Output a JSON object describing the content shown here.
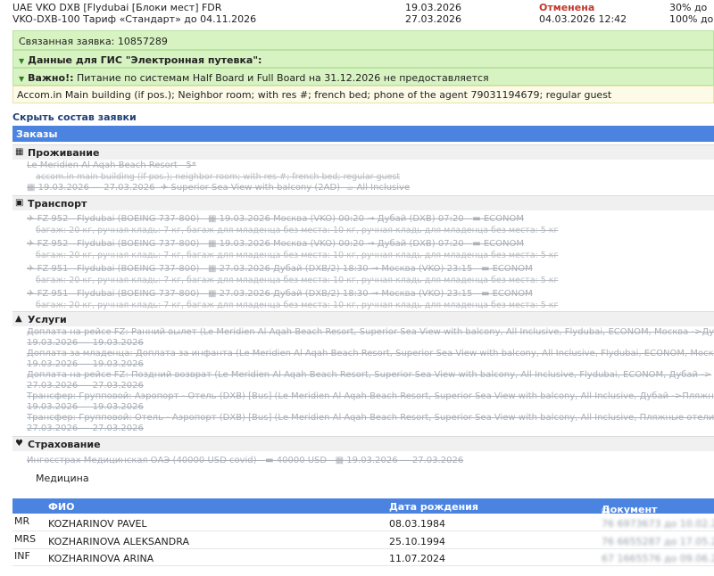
{
  "order": {
    "title_line1": "UAE VKO DXB [Flydubai [Блоки мест] FDR",
    "title_line2": "VKO-DXB-100 Тариф «Стандарт» до 04.11.2026",
    "date1": "19.03.2026",
    "date2": "27.03.2026",
    "status": "Отменена",
    "status_date": "04.03.2026 12:42",
    "pay1": "30% до",
    "pay2": "100% до"
  },
  "linked": {
    "label": "Связанная заявка:",
    "number": "10857289"
  },
  "gis_bar": "Данные для ГИС \"Электронная путевка\":",
  "important": {
    "label": "Важно!:",
    "text": "Питание по системам Half Board и Full Board на 31.12.2026 не предоставляется"
  },
  "accom_note": "Accom.in Main building (if pos.); Neighbor room; with res #; french bed; phone of the agent 79031194679; regular guest",
  "hide_link": "Скрыть состав заявки",
  "orders_title": "Заказы",
  "accommodation": {
    "title": "Проживание",
    "hotel": "Le Meridien Al Aqah Beach Resort",
    "stars": "5*",
    "note": "accom.in main building (if pos.); neighbor room; with res #; french bed; regular guest",
    "date_from": "19.03.2026",
    "date_to": "27.03.2026",
    "room": "Superior Sea View with balcony (2AD)",
    "meal": "All Inclusive"
  },
  "transport": {
    "title": "Транспорт",
    "flights": [
      {
        "code": "FZ 952",
        "carrier": "Flydubai (BOEING 737-800)",
        "route": "19.03.2026 Москва (VKO) 00:20 → Дубай (DXB) 07:20",
        "cls": "ECONOM",
        "bag": "багаж: 20 кг, ручная кладь: 7 кг, багаж для младенца без места: 10 кг, ручная кладь для младенца без места: 5 кг"
      },
      {
        "code": "FZ 952",
        "carrier": "Flydubai (BOEING 737-800)",
        "route": "19.03.2026 Москва (VKO) 00:20 → Дубай (DXB) 07:20",
        "cls": "ECONOM",
        "bag": "багаж: 20 кг, ручная кладь: 7 кг, багаж для младенца без места: 10 кг, ручная кладь для младенца без места: 5 кг"
      },
      {
        "code": "FZ 951",
        "carrier": "Flydubai (BOEING 737-800)",
        "route": "27.03.2026 Дубай (DXB/2) 18:30 → Москва (VKO) 23:15",
        "cls": "ECONOM",
        "bag": "багаж: 20 кг, ручная кладь: 7 кг, багаж для младенца без места: 10 кг, ручная кладь для младенца без места: 5 кг"
      },
      {
        "code": "FZ 951",
        "carrier": "Flydubai (BOEING 737-800)",
        "route": "27.03.2026 Дубай (DXB/2) 18:30 → Москва (VKO) 23:15",
        "cls": "ECONOM",
        "bag": "багаж: 20 кг, ручная кладь: 7 кг, багаж для младенца без места: 10 кг, ручная кладь для младенца без места: 5 кг"
      }
    ]
  },
  "services": {
    "title": "Услуги",
    "items": [
      {
        "text": "Доплата на рейсе FZ: Ранний вылет (Le Meridien Al Aqah Beach Resort, Superior Sea View with balcony, All Inclusive, Flydubai, ECONOM, Москва ->Дуб",
        "dates": "19.03.2026 — 19.03.2026"
      },
      {
        "text": "Доплата за младенца: Доплата за инфанта (Le Meridien Al Aqah Beach Resort, Superior Sea View with balcony, All Inclusive, Flydubai, ECONOM, Москва",
        "dates": "19.03.2026 — 19.03.2026"
      },
      {
        "text": "Доплата на рейсе FZ: Поздний возврат (Le Meridien Al Aqah Beach Resort, Superior Sea View with balcony, All Inclusive, Flydubai, ECONOM, Дубай ->",
        "dates": "27.03.2026 — 27.03.2026"
      },
      {
        "text": "Трансфер: Групповой: Аэропорт - Отель (DXB) [Bus] (Le Meridien Al Aqah Beach Resort, Superior Sea View with balcony, All Inclusive, Дубай ->Пляжн",
        "dates": "19.03.2026 — 19.03.2026"
      },
      {
        "text": "Трансфер: Групповой: Отель - Аэропорт (DXB) [Bus] (Le Meridien Al Aqah Beach Resort, Superior Sea View with balcony, All Inclusive, Пляжные отели",
        "dates": "27.03.2026 — 27.03.2026"
      }
    ]
  },
  "insurance": {
    "title": "Страхование",
    "name": "Ингосстрах Медицинская ОАЭ (40000 USD covid)",
    "amount": "40000 USD",
    "date_from": "19.03.2026",
    "date_to": "27.03.2026",
    "type": "Медицина"
  },
  "pax": {
    "col_name": "ФИО",
    "col_birth": "Дата рождения",
    "col_doc": "Документ",
    "rows": [
      {
        "type": "MR",
        "name": "KOZHARINOV PAVEL",
        "birth": "08.03.1984",
        "doc": "76 6973673 до 10.02.2030"
      },
      {
        "type": "MRS",
        "name": "KOZHARINOVA ALEKSANDRA",
        "birth": "25.10.1994",
        "doc": "76 6655287 до 17.05.2030"
      },
      {
        "type": "INF",
        "name": "KOZHARINOVA ARINA",
        "birth": "11.07.2024",
        "doc": "67 1665576 до 09.06.2029"
      }
    ]
  }
}
